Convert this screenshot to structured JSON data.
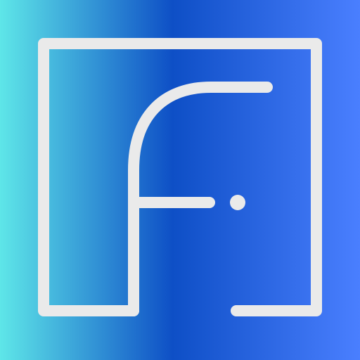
{
  "icon": {
    "name": "facebook-style-logo-icon",
    "gradient_colors": {
      "left": "#5EE6E8",
      "middle": "#0E4FC6",
      "right": "#4A7FFF"
    },
    "stroke_color": "#EAEAEA"
  }
}
